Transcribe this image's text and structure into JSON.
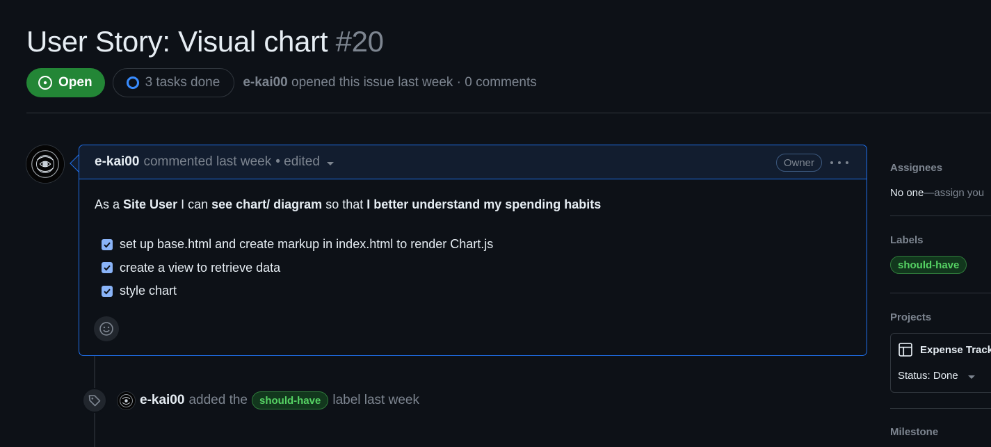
{
  "issue": {
    "title": "User Story: Visual chart",
    "number": "#20",
    "state": "Open",
    "tasks_done": "3 tasks done",
    "meta_author": "e-kai00",
    "meta_text": "opened this issue last week · 0 comments"
  },
  "comment": {
    "author": "e-kai00",
    "action": "commented last week",
    "edited": "• edited",
    "owner_badge": "Owner",
    "story": {
      "p1": "As a ",
      "role": "Site User",
      "p2": " I can ",
      "feature": "see chart/ diagram",
      "p3": " so that ",
      "benefit": "I better understand my spending habits"
    },
    "tasks": [
      {
        "label": "set up base.html and create markup in index.html to render Chart.js",
        "checked": true
      },
      {
        "label": "create a view to retrieve data",
        "checked": true
      },
      {
        "label": "style chart",
        "checked": true
      }
    ]
  },
  "timeline": {
    "event_author": "e-kai00",
    "event_pre": "added the",
    "event_label": "should-have",
    "event_post": "label last week"
  },
  "sidebar": {
    "assignees_heading": "Assignees",
    "assignees_none": "No one",
    "assignees_link": "—assign you",
    "labels_heading": "Labels",
    "label": "should-have",
    "projects_heading": "Projects",
    "project_name": "Expense Track",
    "project_status": "Status: Done",
    "milestone_heading": "Milestone"
  },
  "colors": {
    "background": "#0d1117",
    "open_green": "#238636",
    "accent_blue": "#1f6feb",
    "label_green": "#56d364",
    "muted": "#7d8590"
  }
}
